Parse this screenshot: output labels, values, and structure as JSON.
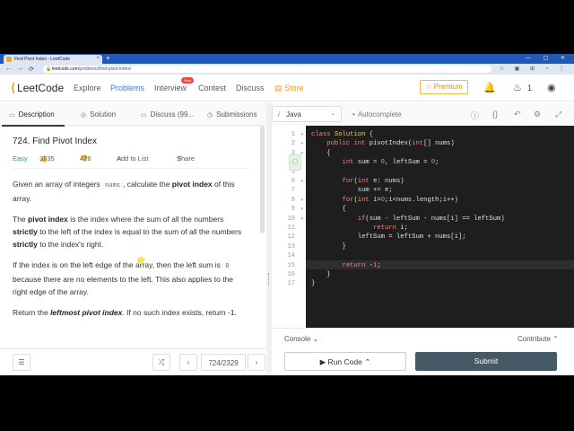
{
  "browser": {
    "tab_title": "Find Pivot Index - LeetCode",
    "tab_close": "×",
    "new_tab": "+",
    "window_controls": "— ▢ ✕",
    "url_host": "leetcode.com",
    "url_path": "/problems/find-pivot-index/",
    "nav_back": "←",
    "nav_forward": "→",
    "nav_reload": "⟳",
    "lock": "🔒",
    "extensions": "☆ ▣ ⊞ ◔ ⋮"
  },
  "site": {
    "logo_mark": "⟨",
    "logo_text": "LeetCode",
    "nav": [
      "Explore",
      "Problems",
      "Interview",
      "Contest",
      "Discuss"
    ],
    "new_badge": "New",
    "store": "Store",
    "store_icon": "▤",
    "premium": "Premium",
    "premium_icon": "☆",
    "bell_icon": "🔔",
    "fire_icon": "♨",
    "fire_count": "1",
    "avatar_icon": "◉"
  },
  "left_tabs": [
    {
      "icon": "▭",
      "label": "Description"
    },
    {
      "icon": "◎",
      "label": "Solution"
    },
    {
      "icon": "▭",
      "label": "Discuss (99..."
    },
    {
      "icon": "◷",
      "label": "Submissions"
    }
  ],
  "problem": {
    "title": "724. Find Pivot Index",
    "difficulty": "Easy",
    "likes": "3735",
    "dislikes": "426",
    "add_to_list": "Add to List",
    "share": "Share",
    "like_icon": "👍",
    "dislike_icon": "👎",
    "list_icon": "☆",
    "share_icon": "⇪",
    "p1_a": "Given an array of integers ",
    "p1_code": "nums",
    "p1_b": ", calculate the ",
    "p1_bold": "pivot index",
    "p1_c": " of this array.",
    "p2_a": "The ",
    "p2_bold1": "pivot index",
    "p2_b": " is the index where the sum of all the numbers ",
    "p2_bold2": "strictly",
    "p2_c": " to the left of the index is equal to the sum of all the numbers ",
    "p2_bold3": "strictly",
    "p2_d": " to the index's right.",
    "p3_a": "If the index is on the left edge of the array, then the left sum is ",
    "p3_code": "0",
    "p3_b": " because there are no elements to the left. This also applies to the right edge of the array.",
    "p4_a": "Return the ",
    "p4_bold": "leftmost pivot index",
    "p4_b": ". If no such index exists, return -1."
  },
  "left_footer": {
    "list_icon": "☰",
    "shuffle_icon": "⤮",
    "prev": "‹",
    "page": "724/2329",
    "next": "›"
  },
  "editor_toolbar": {
    "lang_icon": "i",
    "language": "Java",
    "dropdown": "⌄",
    "autocomplete_dot": "•",
    "autocomplete": "Autocomplete",
    "icons": [
      "ⓘ",
      "{}",
      "↶",
      "⚙",
      "⤢"
    ]
  },
  "code": {
    "line_numbers": [
      "1",
      "2",
      "3",
      "4",
      "5",
      "6",
      "7",
      "8",
      "9",
      "10",
      "11",
      "12",
      "13",
      "14",
      "15",
      "16",
      "17"
    ],
    "fold_markers": [
      "▾",
      "▾",
      "▾",
      "",
      "",
      "▾",
      "",
      "▾",
      "▾",
      "▾",
      "",
      "",
      "",
      "",
      "",
      "",
      ""
    ]
  },
  "console": {
    "label": "Console ⌄",
    "contribute": "Contribute ⌃"
  },
  "actions": {
    "run": "▶  Run Code ⌃",
    "submit": "Submit"
  }
}
